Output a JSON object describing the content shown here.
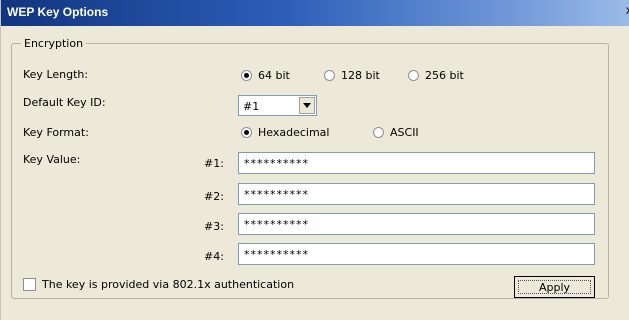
{
  "window": {
    "title": "WEP Key Options",
    "close_glyph": "x"
  },
  "encryption": {
    "legend": "Encryption",
    "key_length": {
      "label": "Key Length:",
      "options": [
        "64 bit",
        "128 bit",
        "256 bit"
      ],
      "selected": "64 bit"
    },
    "default_key_id": {
      "label": "Default Key ID:",
      "value": "#1"
    },
    "key_format": {
      "label": "Key Format:",
      "options": [
        "Hexadecimal",
        "ASCII"
      ],
      "selected": "Hexadecimal"
    },
    "key_value": {
      "label": "Key Value:",
      "keys": [
        {
          "id": "#1:",
          "value": "**********"
        },
        {
          "id": "#2:",
          "value": "**********"
        },
        {
          "id": "#3:",
          "value": "**********"
        },
        {
          "id": "#4:",
          "value": "**********"
        }
      ]
    },
    "auth_checkbox": {
      "label": "The key is provided via 802.1x authentication",
      "checked": false
    },
    "apply_label": "Apply"
  }
}
